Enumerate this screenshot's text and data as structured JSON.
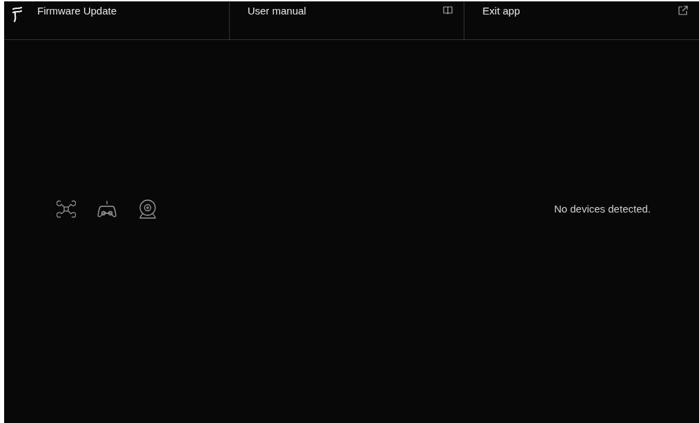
{
  "header": {
    "items": [
      {
        "kind": "brand",
        "label": "Firmware Update"
      },
      {
        "kind": "manual",
        "label": "User manual"
      },
      {
        "kind": "exit",
        "label": "Exit app"
      }
    ]
  },
  "device_types": [
    {
      "kind": "drone"
    },
    {
      "kind": "controller"
    },
    {
      "kind": "camera"
    }
  ],
  "status": "No devices detected."
}
